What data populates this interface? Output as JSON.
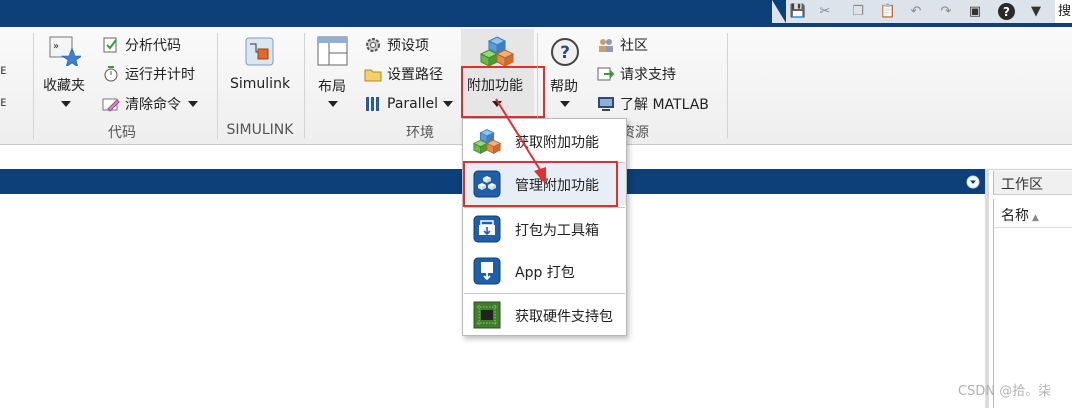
{
  "window": {
    "search_text": "搜"
  },
  "ribbon": {
    "code": {
      "favorites_label": "收藏夹",
      "analyze_label": "分析代码",
      "run_time_label": "运行并计时",
      "clear_commands_label": "清除命令",
      "section_label": "代码"
    },
    "simulink": {
      "simulink_label": "Simulink",
      "section_label": "SIMULINK"
    },
    "environment": {
      "layout_label": "布局",
      "preferences_label": "预设项",
      "set_path_label": "设置路径",
      "parallel_label": "Parallel",
      "addons_label": "附加功能",
      "section_label": "环境"
    },
    "resources": {
      "help_label": "帮助",
      "community_label": "社区",
      "request_support_label": "请求支持",
      "learn_matlab_label": "了解 MATLAB",
      "section_label": "资源"
    }
  },
  "addons_menu": [
    {
      "label": "获取附加功能",
      "icon": "addons-cubes-icon"
    },
    {
      "label": "管理附加功能",
      "icon": "manage-addons-icon"
    },
    {
      "label": "打包为工具箱",
      "icon": "package-toolbox-icon"
    },
    {
      "label": "App 打包",
      "icon": "package-app-icon"
    },
    {
      "label": "获取硬件支持包",
      "icon": "hardware-board-icon"
    }
  ],
  "workspace": {
    "title": "工作区",
    "name_column": "名称"
  },
  "watermark": "CSDN @拾。柒",
  "colors": {
    "title_bar": "#0d3f78",
    "highlight": "#e03030"
  }
}
